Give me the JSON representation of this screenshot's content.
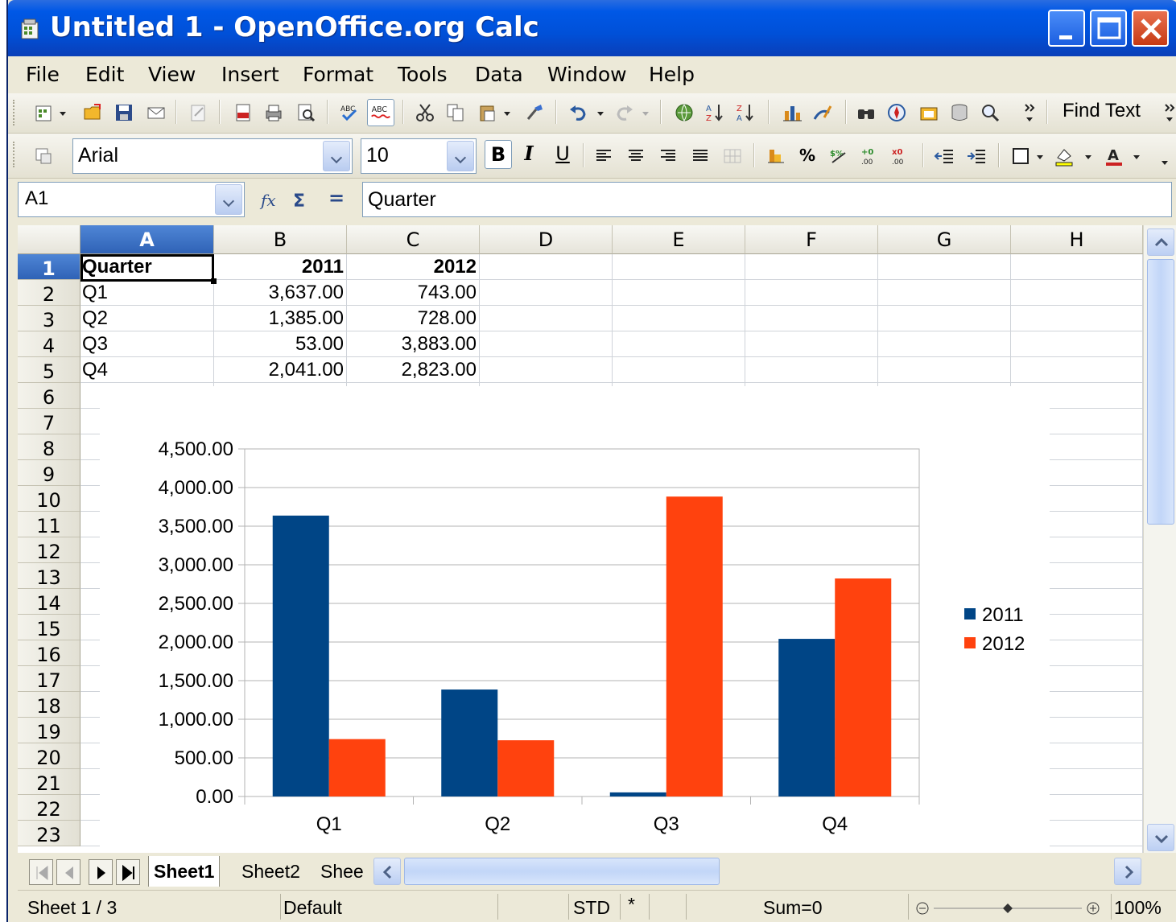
{
  "window": {
    "title": "Untitled 1 - OpenOffice.org Calc"
  },
  "menu": [
    "File",
    "Edit",
    "View",
    "Insert",
    "Format",
    "Tools",
    "Data",
    "Window",
    "Help"
  ],
  "toolbar": {
    "find_text": "Find Text"
  },
  "format_toolbar": {
    "font_name": "Arial",
    "font_size": "10",
    "bold": "B",
    "italic": "I",
    "underline": "U",
    "percent": "%"
  },
  "formula_bar": {
    "cell_ref": "A1",
    "content": "Quarter",
    "equals": "="
  },
  "sheet": {
    "columns": [
      "A",
      "B",
      "C",
      "D",
      "E",
      "F",
      "G",
      "H"
    ],
    "rows": [
      "1",
      "2",
      "3",
      "4",
      "5",
      "6",
      "7",
      "8",
      "9",
      "10",
      "11",
      "12",
      "13",
      "14",
      "15",
      "16",
      "17",
      "18",
      "19",
      "20",
      "21",
      "22",
      "23"
    ],
    "cells": {
      "A1": "Quarter",
      "B1": "2011",
      "C1": "2012",
      "A2": "Q1",
      "B2": "3,637.00",
      "C2": "743.00",
      "A3": "Q2",
      "B3": "1,385.00",
      "C3": "728.00",
      "A4": "Q3",
      "B4": "53.00",
      "C4": "3,883.00",
      "A5": "Q4",
      "B5": "2,041.00",
      "C5": "2,823.00"
    }
  },
  "chart_data": {
    "type": "bar",
    "categories": [
      "Q1",
      "Q2",
      "Q3",
      "Q4"
    ],
    "series": [
      {
        "name": "2011",
        "values": [
          3637,
          1385,
          53,
          2041
        ],
        "color": "#004586"
      },
      {
        "name": "2012",
        "values": [
          743,
          728,
          3883,
          2823
        ],
        "color": "#ff420e"
      }
    ],
    "ylim": [
      0,
      4500
    ],
    "yticks": [
      "0.00",
      "500.00",
      "1,000.00",
      "1,500.00",
      "2,000.00",
      "2,500.00",
      "3,000.00",
      "3,500.00",
      "4,000.00",
      "4,500.00"
    ],
    "grid": true,
    "legend": "right"
  },
  "tabs": [
    "Sheet1",
    "Sheet2",
    "Shee"
  ],
  "status": {
    "sheet": "Sheet 1 / 3",
    "style": "Default",
    "mode": "STD",
    "modified": "*",
    "sum": "Sum=0",
    "zoom": "100%"
  }
}
